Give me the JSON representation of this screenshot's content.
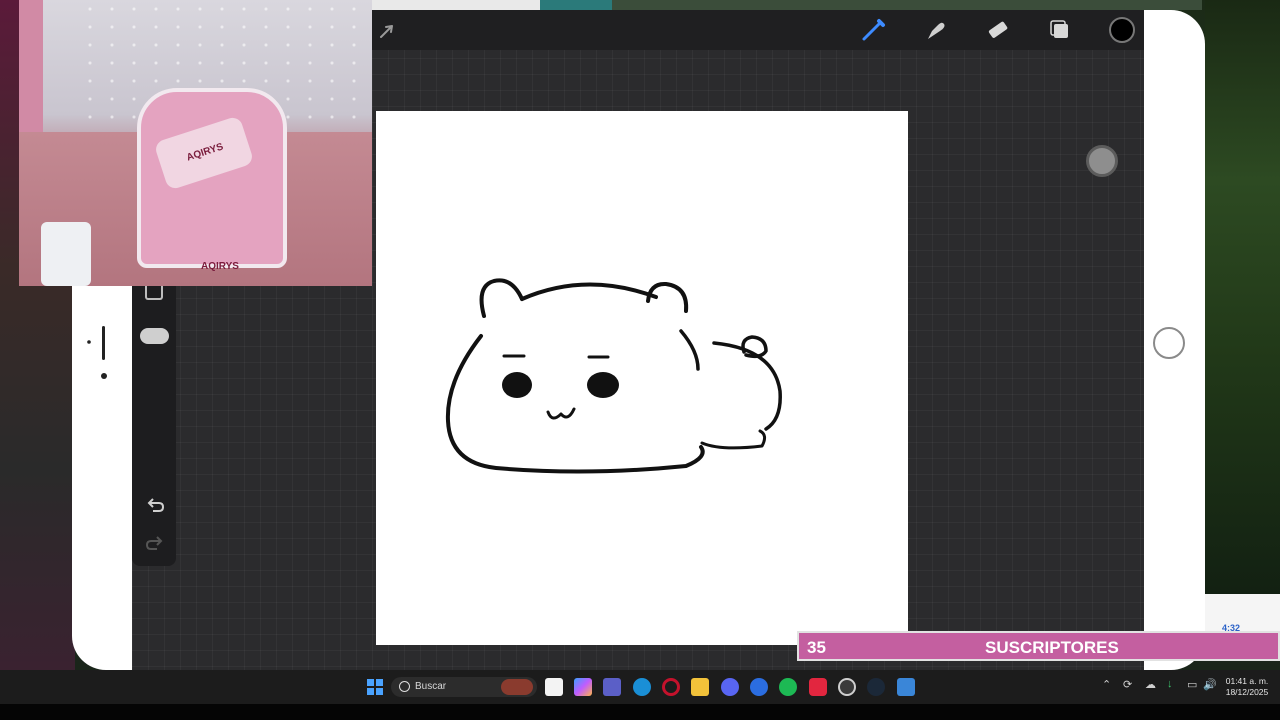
{
  "stream_overlay": {
    "subscriber_count": "35",
    "subscriber_label": "SUSCRIPTORES",
    "popup_time": "4:32"
  },
  "webcam": {
    "chair_brand_top": "AQIRYS",
    "chair_brand_bottom": "AQIRYS"
  },
  "procreate": {
    "toolbar": [
      "brush-tool",
      "smudge-tool",
      "eraser-tool",
      "layers-tool",
      "color-picker"
    ],
    "current_color": "#000000"
  },
  "taskbar": {
    "search_placeholder": "Buscar",
    "apps": [
      "file-explorer",
      "store",
      "copilot",
      "teams",
      "edge",
      "opera",
      "folder",
      "discord",
      "media",
      "spotify",
      "opera-gx",
      "obs",
      "steam",
      "photos"
    ],
    "clock_time": "01:41 a. m.",
    "clock_date": "18/12/2025"
  }
}
